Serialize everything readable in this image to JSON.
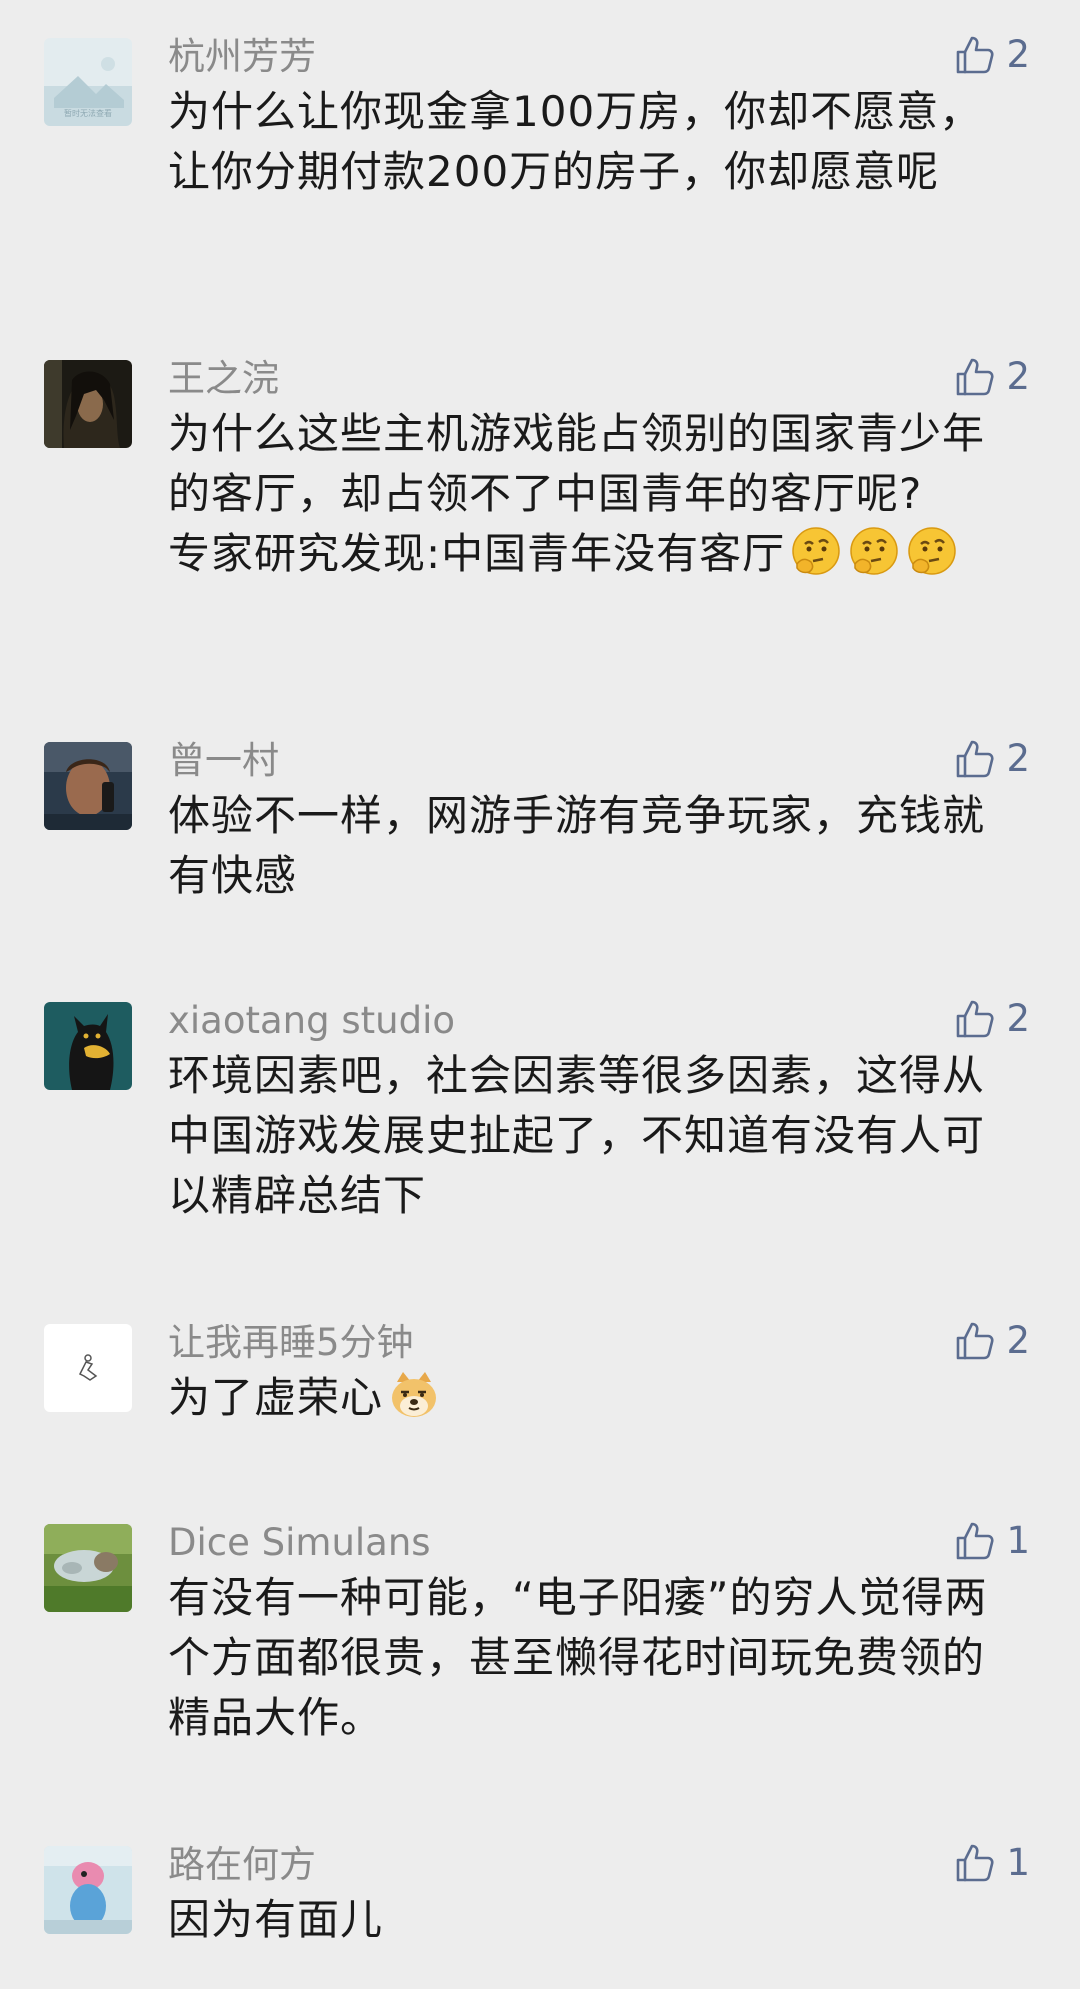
{
  "comments": [
    {
      "name": "杭州芳芳",
      "likes": "2",
      "lines": [
        "为什么让你现金拿100万房，你却不愿意，让你分期付款200万的房子，你却愿意呢"
      ],
      "avatar": "placeholder-image",
      "avatar_text": "暂时无法查看"
    },
    {
      "name": "王之浣",
      "likes": "2",
      "lines": [
        "为什么这些主机游戏能占领别的国家青少年的客厅，却占领不了中国青年的客厅呢?",
        "专家研究发现:中国青年没有客厅"
      ],
      "avatar": "long-hair-man-photo",
      "emoji": "thinking-face-emoji"
    },
    {
      "name": "曾一村",
      "likes": "2",
      "lines": [
        "体验不一样，网游手游有竞争玩家，充钱就有快感"
      ],
      "avatar": "man-on-phone-photo"
    },
    {
      "name": "xiaotang studio",
      "likes": "2",
      "lines": [
        "环境因素吧，社会因素等很多因素，这得从中国游戏发展史扯起了，不知道有没有人可以精辟总结下"
      ],
      "avatar": "black-cat-illustration"
    },
    {
      "name": "让我再睡5分钟",
      "likes": "2",
      "lines": [
        "为了虚荣心"
      ],
      "avatar": "white-sketch",
      "emoji": "doge-emoji"
    },
    {
      "name": "Dice Simulans",
      "likes": "1",
      "lines": [
        "有没有一种可能，“电子阳痿”的穷人觉得两个方面都很贵，甚至懒得花时间玩免费领的精品大作。"
      ],
      "avatar": "dog-on-grass-photo"
    },
    {
      "name": "路在何方",
      "likes": "1",
      "lines": [
        "因为有面儿"
      ],
      "avatar": "pink-mascot-photo"
    }
  ],
  "icons": {
    "like": "thumbs-up-icon"
  },
  "colors": {
    "background": "#ededed",
    "name": "#8a8a8a",
    "like": "#5b6c8f",
    "text": "#1a1a1a"
  }
}
